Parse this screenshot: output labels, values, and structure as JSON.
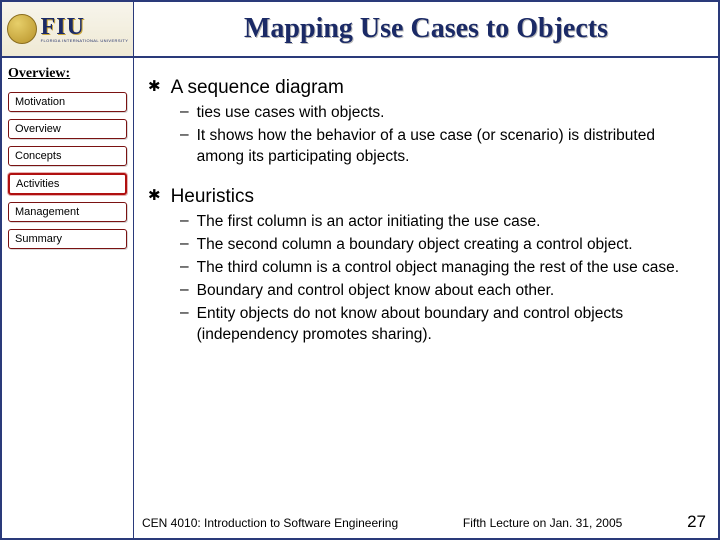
{
  "logo": {
    "abbr": "FIU",
    "sub": "FLORIDA INTERNATIONAL UNIVERSITY"
  },
  "title": "Mapping Use Cases to Objects",
  "sidebar": {
    "heading": "Overview:",
    "items": [
      {
        "label": "Motivation",
        "active": false
      },
      {
        "label": "Overview",
        "active": false
      },
      {
        "label": "Concepts",
        "active": false
      },
      {
        "label": "Activities",
        "active": true
      },
      {
        "label": "Management",
        "active": false
      },
      {
        "label": "Summary",
        "active": false
      }
    ]
  },
  "content": {
    "points": [
      {
        "text": "A sequence diagram",
        "subs": [
          "ties use cases with objects.",
          "It shows how the behavior of a use case (or scenario) is distributed among its participating objects."
        ]
      },
      {
        "text": "Heuristics",
        "subs": [
          "The first column is an actor initiating the use case.",
          "The second column a boundary object creating a control object.",
          "The third column is a control object managing the rest of the use case.",
          "Boundary and control object know about each other.",
          "Entity objects do not know about boundary and control objects (independency promotes sharing)."
        ]
      }
    ]
  },
  "footer": {
    "course": "CEN 4010: Introduction to Software Engineering",
    "lecture": "Fifth Lecture on Jan. 31, 2005",
    "page": "27"
  }
}
